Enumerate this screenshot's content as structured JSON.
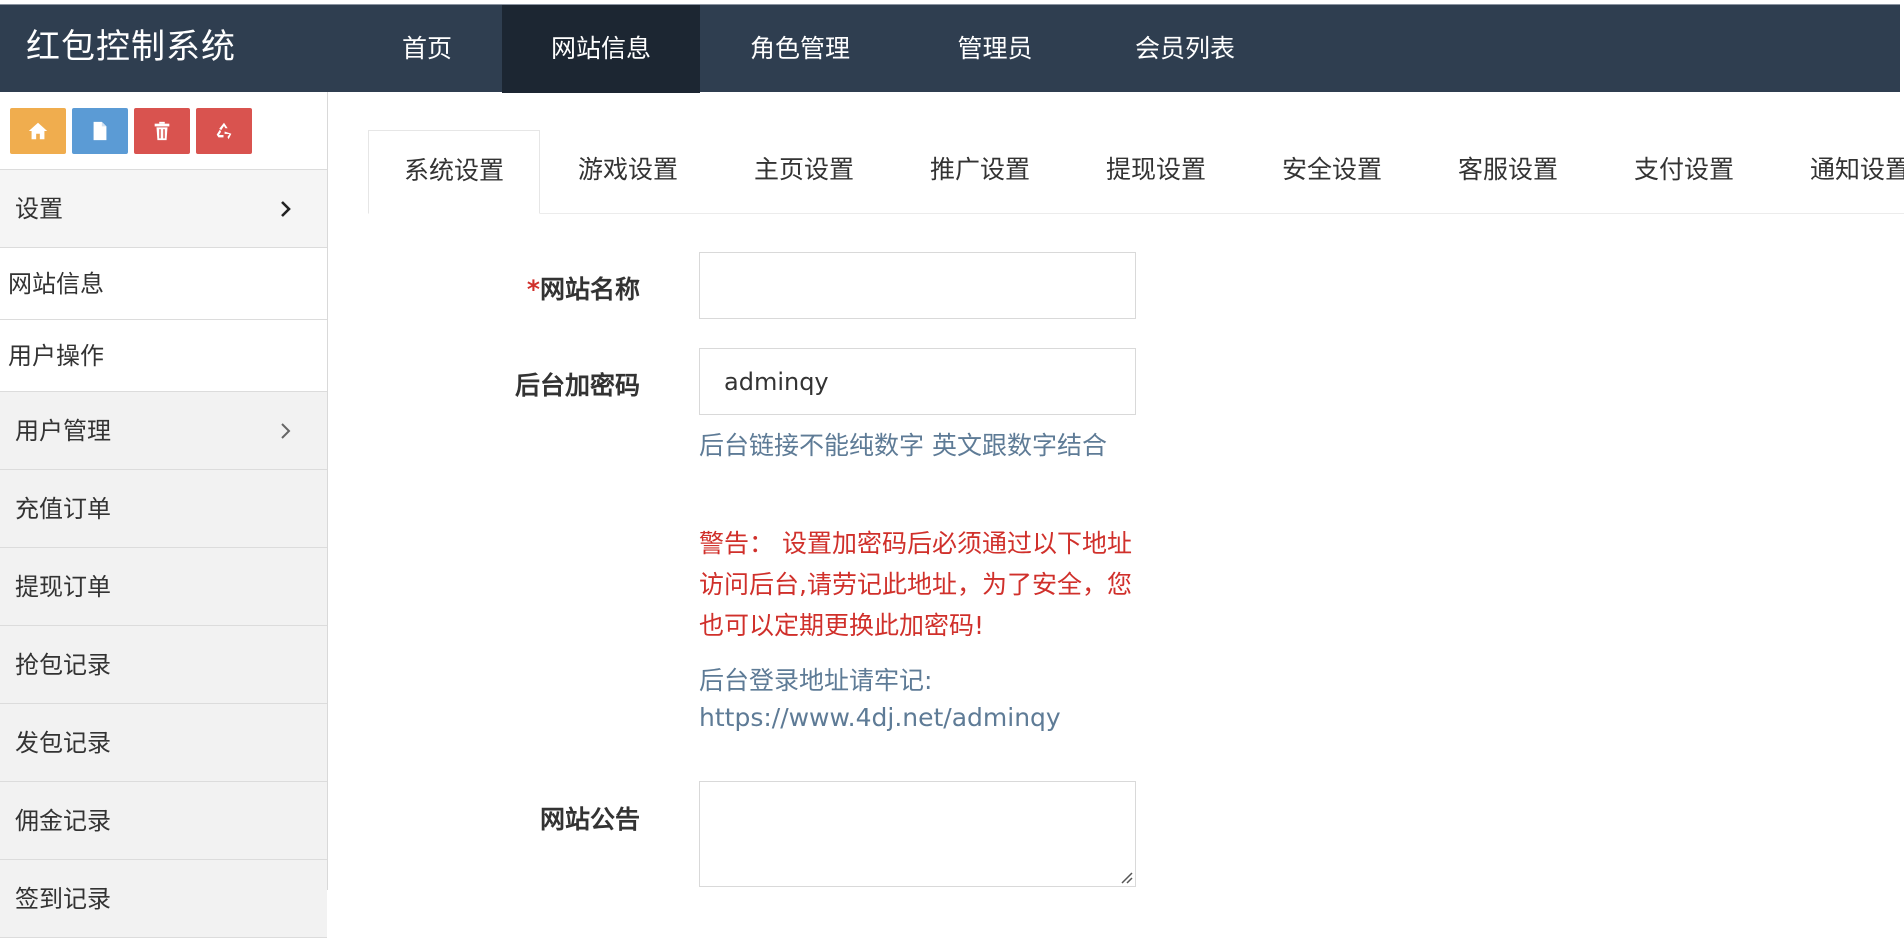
{
  "app": {
    "brand": "红包控制系统"
  },
  "topnav": [
    {
      "label": "首页",
      "active": false
    },
    {
      "label": "网站信息",
      "active": true
    },
    {
      "label": "角色管理",
      "active": false
    },
    {
      "label": "管理员",
      "active": false
    },
    {
      "label": "会员列表",
      "active": false
    }
  ],
  "toolbar": {
    "buttons": [
      {
        "name": "home-button",
        "icon": "home-icon",
        "color": "#f0ad4e"
      },
      {
        "name": "new-page-button",
        "icon": "file-icon",
        "color": "#5b9bd5"
      },
      {
        "name": "delete-button",
        "icon": "trash-icon",
        "color": "#d9534f"
      },
      {
        "name": "recycle-button",
        "icon": "recycle-icon",
        "color": "#d9534f"
      }
    ]
  },
  "sidebar": {
    "items": [
      {
        "label": "设置",
        "has_arrow": true
      },
      {
        "label": "网站信息",
        "has_arrow": false
      },
      {
        "label": "用户操作",
        "has_arrow": false
      },
      {
        "label": "用户管理",
        "has_arrow": true
      },
      {
        "label": "充值订单",
        "has_arrow": false
      },
      {
        "label": "提现订单",
        "has_arrow": false
      },
      {
        "label": "抢包记录",
        "has_arrow": false
      },
      {
        "label": "发包记录",
        "has_arrow": false
      },
      {
        "label": "佣金记录",
        "has_arrow": false
      },
      {
        "label": "签到记录",
        "has_arrow": false
      }
    ]
  },
  "tabs": [
    {
      "label": "系统设置",
      "active": true
    },
    {
      "label": "游戏设置",
      "active": false
    },
    {
      "label": "主页设置",
      "active": false
    },
    {
      "label": "推广设置",
      "active": false
    },
    {
      "label": "提现设置",
      "active": false
    },
    {
      "label": "安全设置",
      "active": false
    },
    {
      "label": "客服设置",
      "active": false
    },
    {
      "label": "支付设置",
      "active": false
    },
    {
      "label": "通知设置",
      "active": false
    }
  ],
  "form": {
    "site_name": {
      "required_mark": "*",
      "label": "网站名称",
      "value": ""
    },
    "admin_key": {
      "label": "后台加密码",
      "value": "adminqy"
    },
    "admin_key_hint": "后台链接不能纯数字 英文跟数字结合",
    "warning": "警告： 设置加密码后必须通过以下地址访问后台,请劳记此地址，为了安全，您也可以定期更换此加密码!",
    "login_hint_label": "后台登录地址请牢记:",
    "login_url": "https://www.4dj.net/adminqy",
    "notice": {
      "label": "网站公告",
      "value": ""
    }
  },
  "colors": {
    "topbar": "#2f3e50",
    "topbar_active": "#1c2632",
    "hint": "#5e7b96",
    "warning": "#d0302b"
  }
}
